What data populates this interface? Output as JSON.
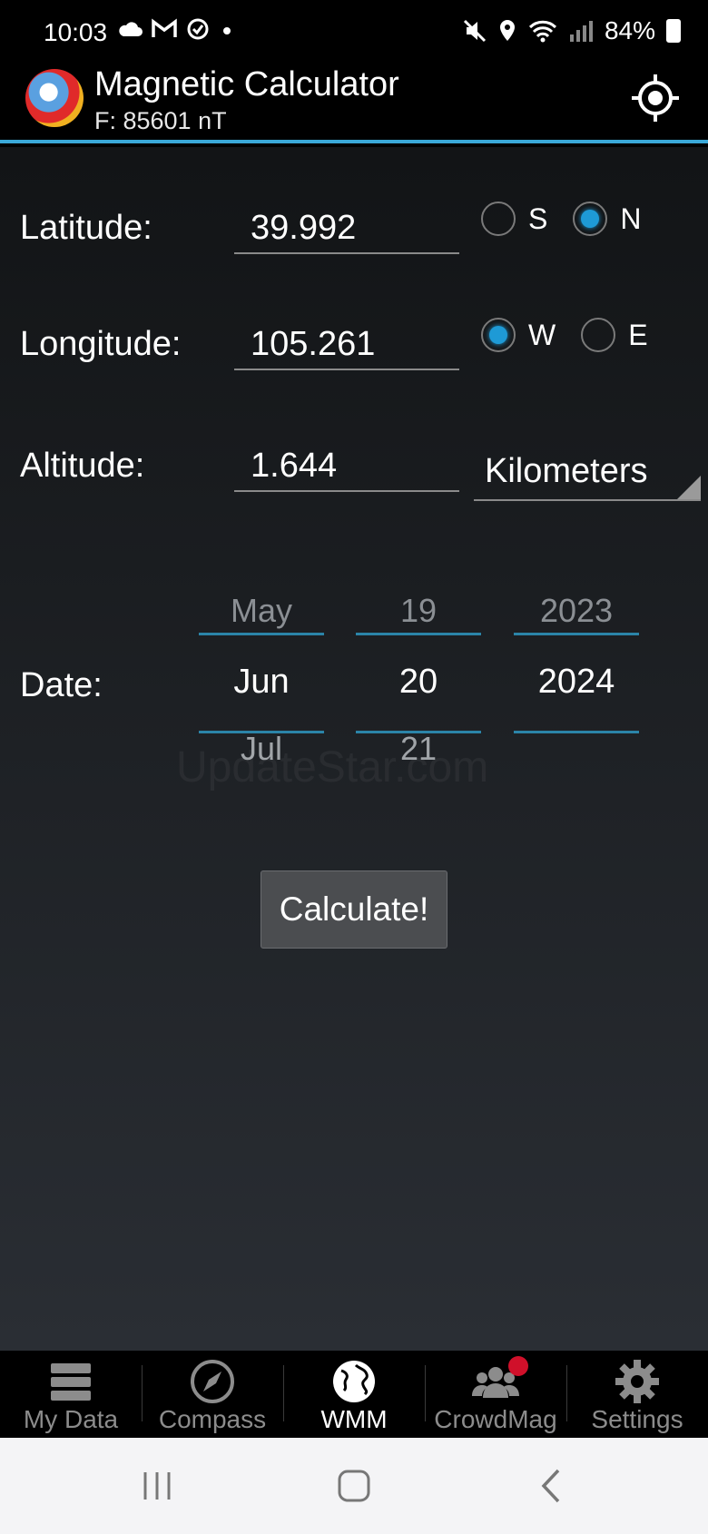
{
  "status_bar": {
    "time": "10:03",
    "battery": "84%",
    "left_icons": [
      "cloud-icon",
      "gmail-icon",
      "sync-icon",
      "dot-icon"
    ],
    "right_icons": [
      "mute-icon",
      "location-icon",
      "wifi-icon",
      "signal-icon",
      "battery-icon"
    ]
  },
  "app_bar": {
    "title": "Magnetic Calculator",
    "subtitle": "F: 85601 nT",
    "action_icon": "crosshair-icon"
  },
  "form": {
    "latitude": {
      "label": "Latitude:",
      "value": "39.992",
      "options": [
        {
          "label": "S",
          "checked": false
        },
        {
          "label": "N",
          "checked": true
        }
      ]
    },
    "longitude": {
      "label": "Longitude:",
      "value": "105.261",
      "options": [
        {
          "label": "W",
          "checked": true
        },
        {
          "label": "E",
          "checked": false
        }
      ]
    },
    "altitude": {
      "label": "Altitude:",
      "value": "1.644",
      "unit": "Kilometers"
    },
    "date": {
      "label": "Date:",
      "month": {
        "prev": "May",
        "current": "Jun",
        "next": "Jul"
      },
      "day": {
        "prev": "19",
        "current": "20",
        "next": "21"
      },
      "year": {
        "prev": "2023",
        "current": "2024",
        "next": ""
      }
    },
    "calculate_label": "Calculate!"
  },
  "watermark": "UpdateStar.com",
  "bottom_nav": {
    "items": [
      {
        "label": "My Data",
        "icon": "database-icon",
        "active": false
      },
      {
        "label": "Compass",
        "icon": "compass-icon",
        "active": false
      },
      {
        "label": "WMM",
        "icon": "globe-icon",
        "active": true
      },
      {
        "label": "CrowdMag",
        "icon": "group-icon",
        "active": false
      },
      {
        "label": "Settings",
        "icon": "gear-icon",
        "active": false
      }
    ]
  },
  "colors": {
    "accent": "#1e9ad6",
    "divider": "#3aa8d8",
    "badge": "#d0102a"
  }
}
